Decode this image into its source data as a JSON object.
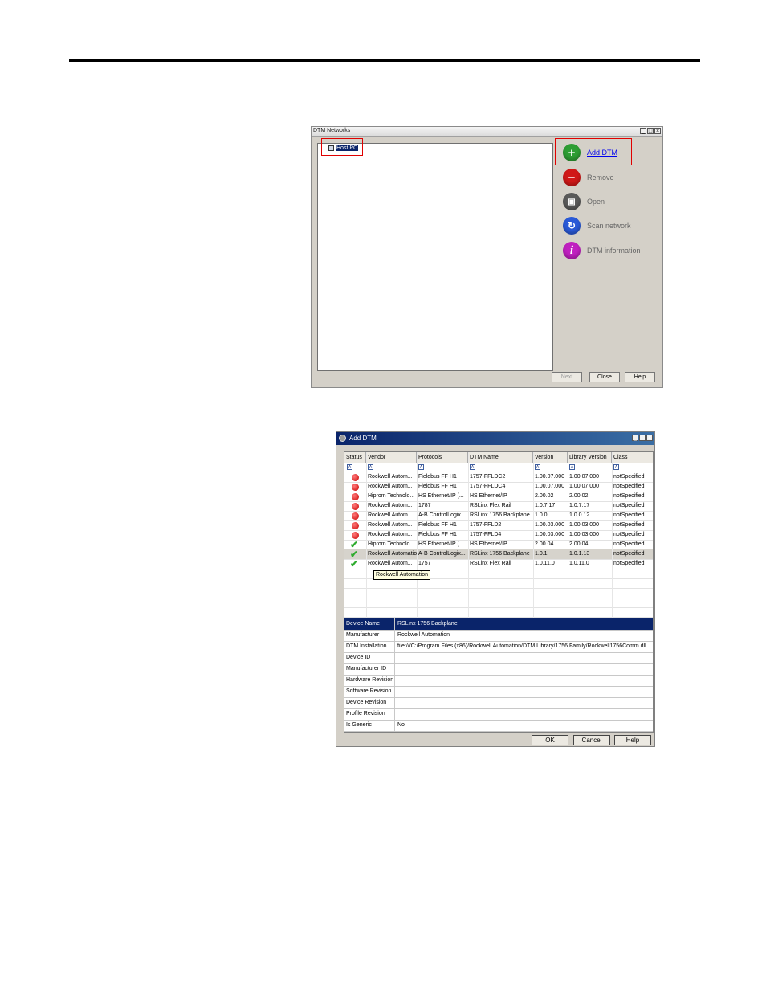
{
  "dtm_networks": {
    "title": "DTM Networks",
    "tree_root": "Host PC",
    "actions": [
      {
        "label": "Add DTM",
        "icon": "plus-icon",
        "color": "#2e9e34"
      },
      {
        "label": "Remove",
        "icon": "minus-icon",
        "color": "#d01818"
      },
      {
        "label": "Open",
        "icon": "open-icon",
        "color": "#5a5a5a"
      },
      {
        "label": "Scan network",
        "icon": "scan-icon",
        "color": "#2a5ad8"
      },
      {
        "label": "DTM information",
        "icon": "info-icon",
        "color": "#c020c0"
      }
    ],
    "buttons": {
      "next": "Next",
      "close": "Close",
      "help": "Help"
    }
  },
  "add_dtm": {
    "title": "Add DTM",
    "columns": [
      "Status",
      "Vendor",
      "Protocols",
      "DTM Name",
      "Version",
      "Library Version",
      "Class"
    ],
    "rows": [
      {
        "status": "error",
        "vendor": "Rockwell Autom...",
        "protocol": "Fieldbus FF H1",
        "name": "1757-FFLDC2",
        "version": "1.00.07.000",
        "lib": "1.00.07.000",
        "class": "notSpecified"
      },
      {
        "status": "error",
        "vendor": "Rockwell Autom...",
        "protocol": "Fieldbus FF H1",
        "name": "1757-FFLDC4",
        "version": "1.00.07.000",
        "lib": "1.00.07.000",
        "class": "notSpecified"
      },
      {
        "status": "error",
        "vendor": "Hiprom Technolo...",
        "protocol": "HS Ethernet/IP (...",
        "name": "HS Ethernet/IP",
        "version": "2.00.02",
        "lib": "2.00.02",
        "class": "notSpecified"
      },
      {
        "status": "error",
        "vendor": "Rockwell Autom...",
        "protocol": "1787",
        "name": "RSLinx Flex Rail",
        "version": "1.0.7.17",
        "lib": "1.0.7.17",
        "class": "notSpecified"
      },
      {
        "status": "error",
        "vendor": "Rockwell Autom...",
        "protocol": "A-B ControlLogix...",
        "name": "RSLinx 1756 Backplane",
        "version": "1.0.0",
        "lib": "1.0.0.12",
        "class": "notSpecified"
      },
      {
        "status": "error",
        "vendor": "Rockwell Autom...",
        "protocol": "Fieldbus FF H1",
        "name": "1757-FFLD2",
        "version": "1.00.03.000",
        "lib": "1.00.03.000",
        "class": "notSpecified"
      },
      {
        "status": "error",
        "vendor": "Rockwell Autom...",
        "protocol": "Fieldbus FF H1",
        "name": "1757-FFLD4",
        "version": "1.00.03.000",
        "lib": "1.00.03.000",
        "class": "notSpecified"
      },
      {
        "status": "ok",
        "vendor": "Hiprom Technolo...",
        "protocol": "HS Ethernet/IP (...",
        "name": "HS Ethernet/IP",
        "version": "2.00.04",
        "lib": "2.00.04",
        "class": "notSpecified"
      },
      {
        "status": "ok",
        "vendor": "Rockwell Automation",
        "protocol": "A-B ControlLogix...",
        "name": "RSLinx 1756 Backplane",
        "version": "1.0.1",
        "lib": "1.0.1.13",
        "class": "notSpecified"
      },
      {
        "status": "ok",
        "vendor": "Rockwell Autom...",
        "protocol": "1757",
        "name": "RSLinx Flex Rail",
        "version": "1.0.11.0",
        "lib": "1.0.11.0",
        "class": "notSpecified"
      }
    ],
    "tooltip": "Rockwell Automation",
    "properties": [
      {
        "key": "Device Name",
        "value": "RSLinx 1756 Backplane"
      },
      {
        "key": "Manufacturer",
        "value": "Rockwell Automation"
      },
      {
        "key": "DTM Installation ...",
        "value": "file:///C:/Program Files (x86)/Rockwell Automation/DTM Library/1756 Family/Rockwell1756Comm.dll"
      },
      {
        "key": "Device ID",
        "value": ""
      },
      {
        "key": "Manufacturer ID",
        "value": ""
      },
      {
        "key": "Hardware Revision",
        "value": ""
      },
      {
        "key": "Software Revision",
        "value": ""
      },
      {
        "key": "Device Revision",
        "value": ""
      },
      {
        "key": "Profile Revision",
        "value": ""
      },
      {
        "key": "Is Generic",
        "value": "No"
      }
    ],
    "buttons": {
      "ok": "OK",
      "cancel": "Cancel",
      "help": "Help"
    }
  }
}
